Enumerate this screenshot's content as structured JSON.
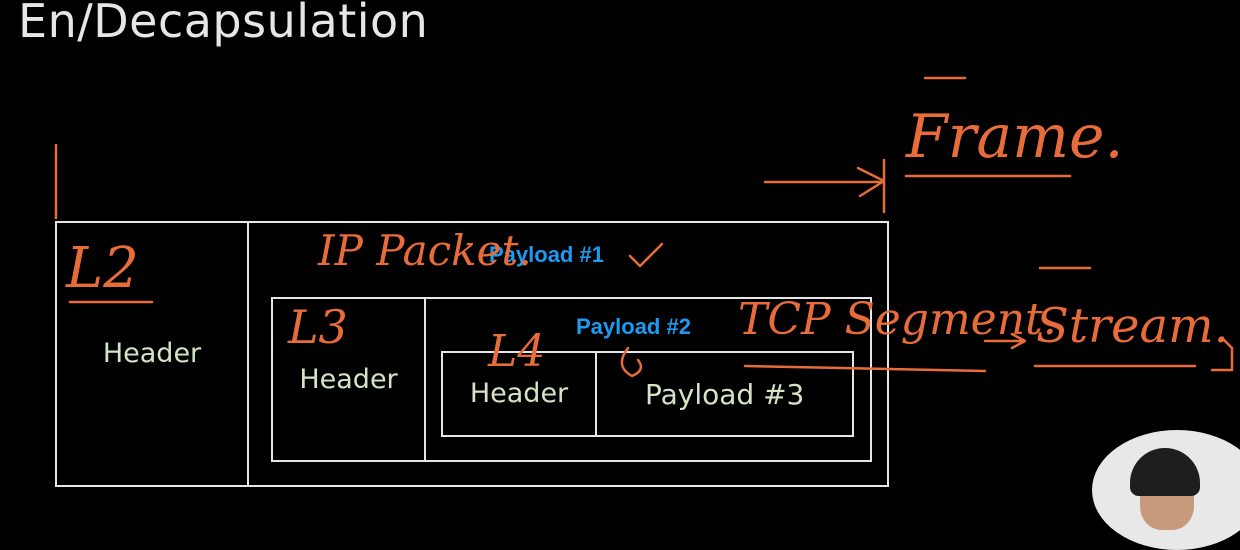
{
  "title": "En/Decapsulation",
  "diagram": {
    "outer": {
      "header_label": "Header",
      "payload_label": "Payload #1"
    },
    "middle": {
      "header_label": "Header",
      "payload_label": "Payload #2"
    },
    "inner": {
      "header_label": "Header",
      "payload_label": "Payload #3"
    }
  },
  "annotations": {
    "l2": "L2",
    "l3": "L3",
    "l4": "L4",
    "ip_packet": "IP Packet.",
    "frame": "Frame.",
    "tcp_segment": "TCP Segment.",
    "stream": "Stream."
  },
  "colors": {
    "background": "#000000",
    "box_line": "#e6e6e6",
    "header_text": "#d4e4c4",
    "payload_accent": "#1d9bf0",
    "ink": "#e86c3a"
  }
}
